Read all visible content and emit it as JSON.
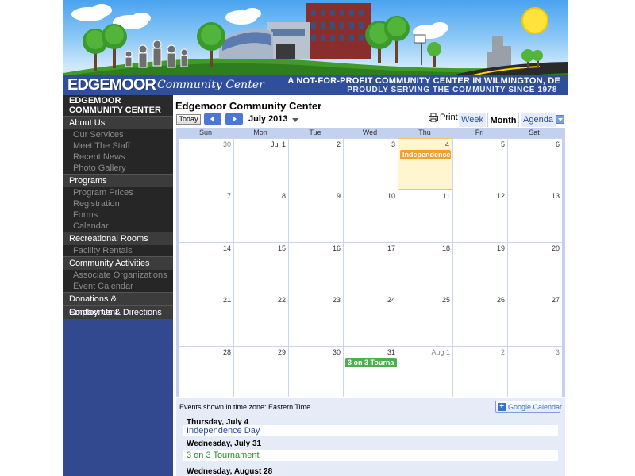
{
  "banner": {
    "logo_main": "EDGEMOOR",
    "logo_script": "Community Center",
    "tagline1": "A NOT-FOR-PROFIT COMMUNITY CENTER IN WILMINGTON, DE",
    "tagline2": "PROUDLY SERVING THE COMMUNITY SINCE 1978"
  },
  "sidebar": {
    "site_title_line1": "EDGEMOOR",
    "site_title_line2": "COMMUNITY CENTER",
    "sections": [
      {
        "label": "About Us",
        "items": [
          "Our Services",
          "Meet The Staff",
          "Recent News",
          "Photo Gallery"
        ]
      },
      {
        "label": "Programs",
        "items": [
          "Program Prices",
          "Registration",
          "Forms",
          "Calendar"
        ]
      },
      {
        "label": "Recreational Rooms",
        "items": [
          "Facility Rentals"
        ]
      },
      {
        "label": "Community Activities",
        "items": [
          "Associate Organizations",
          "Event Calendar"
        ]
      },
      {
        "label": "Donations & Employment",
        "items": []
      },
      {
        "label": "Contact Us & Directions",
        "items": []
      }
    ]
  },
  "calendar": {
    "title": "Edgemoor Community Center",
    "today_label": "Today",
    "month_label": "July 2013",
    "print_label": "Print",
    "views": [
      "Week",
      "Month",
      "Agenda"
    ],
    "selected_view": "Month",
    "days_of_week": [
      "Sun",
      "Mon",
      "Tue",
      "Wed",
      "Thu",
      "Fri",
      "Sat"
    ],
    "weeks": [
      [
        {
          "d": "30",
          "other": true
        },
        {
          "d": "Jul 1"
        },
        {
          "d": "2"
        },
        {
          "d": "3"
        },
        {
          "d": "4",
          "today": true,
          "event": "Independence",
          "event_color": "orange"
        },
        {
          "d": "5"
        },
        {
          "d": "6"
        }
      ],
      [
        {
          "d": "7"
        },
        {
          "d": "8"
        },
        {
          "d": "9"
        },
        {
          "d": "10"
        },
        {
          "d": "11"
        },
        {
          "d": "12"
        },
        {
          "d": "13"
        }
      ],
      [
        {
          "d": "14"
        },
        {
          "d": "15"
        },
        {
          "d": "16"
        },
        {
          "d": "17"
        },
        {
          "d": "18"
        },
        {
          "d": "19"
        },
        {
          "d": "20"
        }
      ],
      [
        {
          "d": "21"
        },
        {
          "d": "22"
        },
        {
          "d": "23"
        },
        {
          "d": "24"
        },
        {
          "d": "25"
        },
        {
          "d": "26"
        },
        {
          "d": "27"
        }
      ],
      [
        {
          "d": "28"
        },
        {
          "d": "29"
        },
        {
          "d": "30"
        },
        {
          "d": "31",
          "event": "3 on 3 Tourna",
          "event_color": "green"
        },
        {
          "d": "Aug 1",
          "other": true
        },
        {
          "d": "2",
          "other": true
        },
        {
          "d": "3",
          "other": true
        }
      ]
    ],
    "timezone_text": "Events shown in time zone: Eastern Time",
    "gcal_label": "Google Calendar",
    "agenda": [
      {
        "date": "Thursday, July 4",
        "title": "Independence Day",
        "color": "#2a4d9c"
      },
      {
        "date": "Wednesday, July 31",
        "title": "3 on 3 Tournament",
        "color": "#2c8a2c"
      },
      {
        "date": "Wednesday, August 28",
        "title": "",
        "color": "#000000"
      }
    ]
  },
  "colors": {
    "nav_bg": "#33498f",
    "accent_blue": "#4d77d5",
    "event_orange": "#f0a030",
    "event_green": "#4cae4c",
    "today_bg": "#fff6d0"
  }
}
